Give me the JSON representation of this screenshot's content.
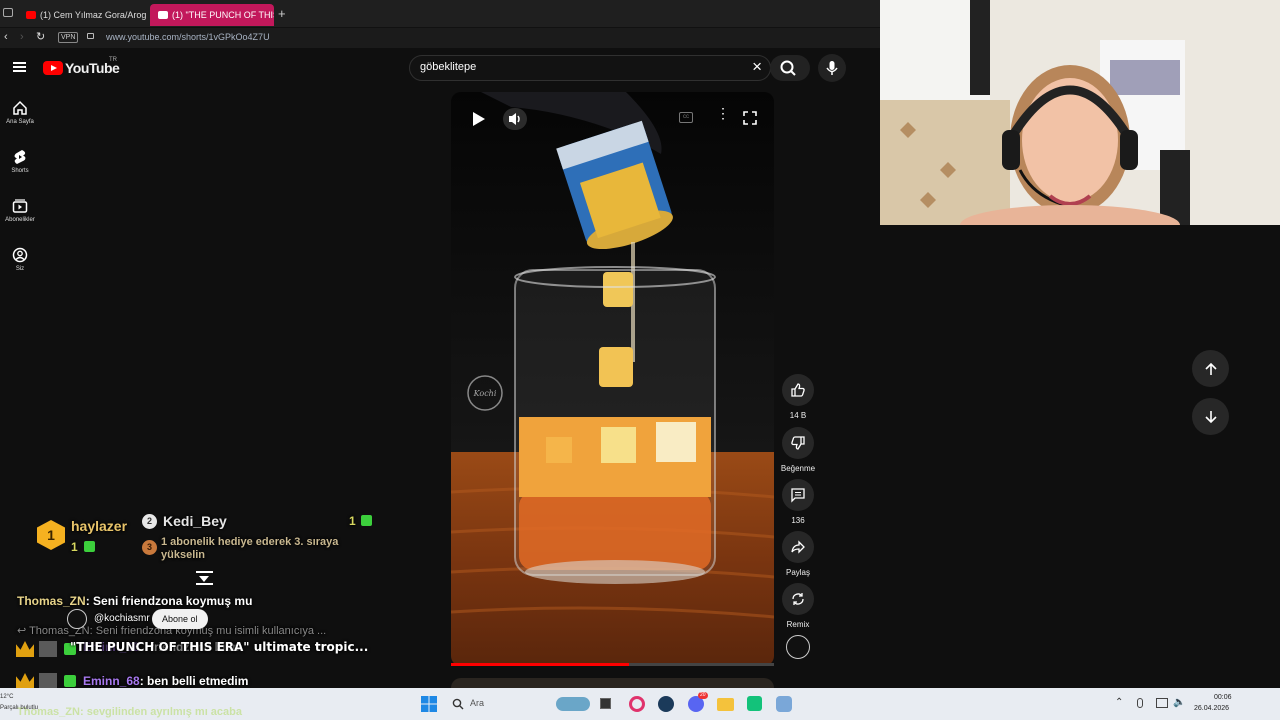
{
  "browser": {
    "tabs": [
      {
        "title": "(1) Cem Yılmaz Gora/Arog"
      },
      {
        "title": "(1) \"THE PUNCH OF THIS E"
      }
    ],
    "vpn_label": "VPN",
    "url": "www.youtube.com/shorts/1vGPkOo4Z7U"
  },
  "youtube": {
    "logo_text": "YouTube",
    "region": "TR",
    "search": {
      "value": "göbeklitepe"
    },
    "sidebar": [
      {
        "label": "Ana Sayfa",
        "icon": "home-icon"
      },
      {
        "label": "Shorts",
        "icon": "shorts-icon"
      },
      {
        "label": "Abonelikler",
        "icon": "subscriptions-icon"
      },
      {
        "label": "Siz",
        "icon": "account-icon"
      }
    ],
    "short": {
      "channel": "@kochiasmr",
      "subscribe_label": "Abone ol",
      "title": "\"THE PUNCH OF THIS ERA\" ultimate tropic...",
      "progress": 0.55,
      "watermark": "Kochi"
    },
    "actions": {
      "likes": "14 B",
      "dislike": "Beğenme",
      "comments": "136",
      "share": "Paylaş",
      "remix": "Remix"
    }
  },
  "stream": {
    "leaderboard": {
      "rank1": {
        "rank": "1",
        "name": "haylazer",
        "count": "1"
      },
      "rank2": {
        "rank": "2",
        "name": "Kedi_Bey",
        "count": "1"
      },
      "rank3": {
        "rank": "3",
        "text": "1 abonelik hediye ederek 3. sıraya yükselin"
      }
    },
    "chat": [
      {
        "user": "Thomas_ZN",
        "message": "Seni friendzona koymuş mu",
        "user_color": "#e8d48a"
      },
      {
        "user": "Thomas_ZN",
        "message": "Seni friendzona koymuş mu isimli kullanıcıya ...",
        "reply": true
      },
      {
        "user": "Eminn_68",
        "message": "friendzonu bilim",
        "user_color": "#a879f0"
      },
      {
        "user": "Eminn_68",
        "message": "ben belli etmedim",
        "user_color": "#a879f0"
      },
      {
        "user": "Thomas_ZN",
        "message": "sevgilinden ayrılmış mı acaba",
        "user_color": "#a8d84a"
      }
    ]
  },
  "taskbar": {
    "weather_temp": "12°C",
    "weather_desc": "Parçalı bulutlu",
    "search_placeholder": "Ara",
    "time": "00:06",
    "date": "26.04.2026",
    "badge_count": "20"
  }
}
